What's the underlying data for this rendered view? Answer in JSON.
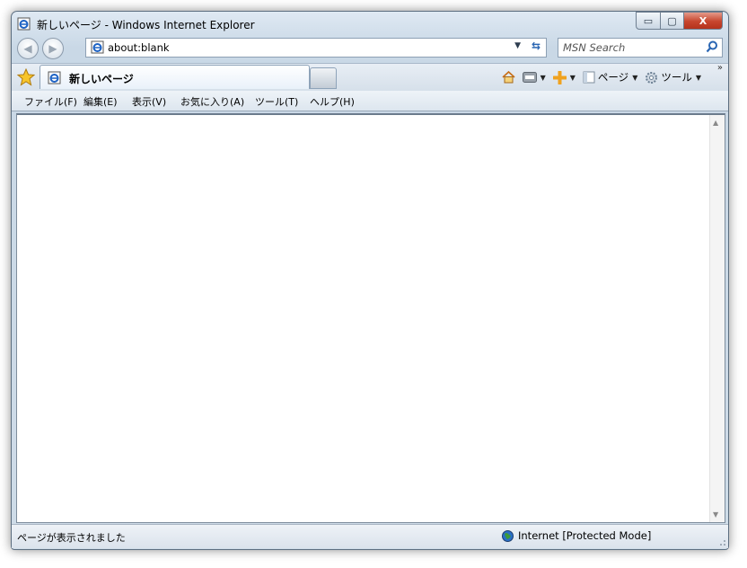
{
  "window": {
    "title": "新しいページ - Windows Internet Explorer"
  },
  "caption": {
    "minimize": "▭",
    "maximize": "▢",
    "close": "X"
  },
  "address": {
    "url": "about:blank"
  },
  "search": {
    "placeholder": "MSN Search"
  },
  "tab": {
    "label": "新しいページ"
  },
  "commandbar": {
    "page_label": "ページ",
    "tools_label": "ツール"
  },
  "menu": {
    "items": [
      "ファイル(F)",
      "編集(E)",
      "表示(V)",
      "お気に入り(A)",
      "ツール(T)",
      "ヘルプ(H)"
    ]
  },
  "status": {
    "text": "ページが表示されました",
    "zone": "Internet [Protected Mode]"
  },
  "colors": {
    "frame": "#cfdce8",
    "close_button": "#c7452d",
    "accent_blue": "#2a66b3"
  },
  "icons": [
    "ie-page-icon",
    "back-icon",
    "forward-icon",
    "refresh-icon",
    "search-icon",
    "favorites-star-icon",
    "home-icon",
    "rss-icon",
    "print-icon",
    "page-icon",
    "gear-icon",
    "globe-icon"
  ]
}
